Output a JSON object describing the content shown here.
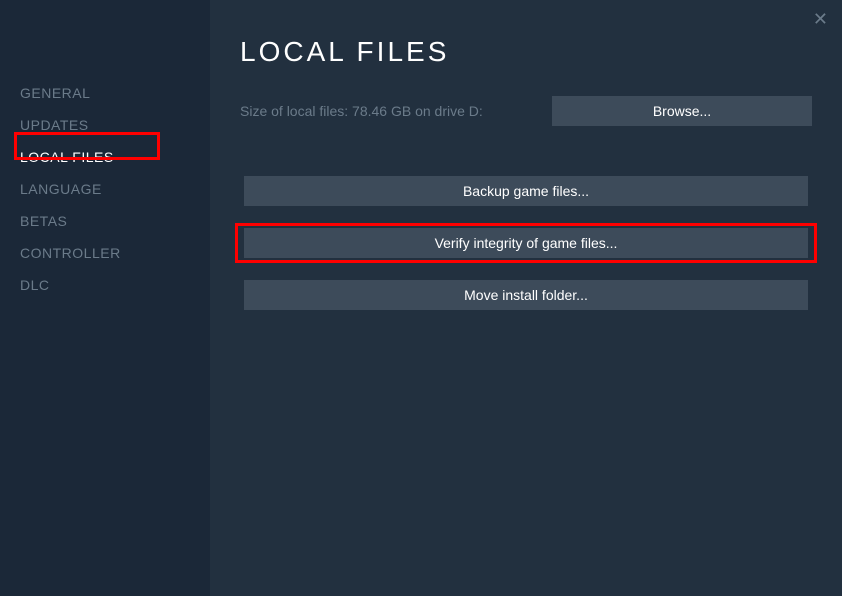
{
  "sidebar": {
    "items": [
      {
        "label": "GENERAL"
      },
      {
        "label": "UPDATES"
      },
      {
        "label": "LOCAL FILES"
      },
      {
        "label": "LANGUAGE"
      },
      {
        "label": "BETAS"
      },
      {
        "label": "CONTROLLER"
      },
      {
        "label": "DLC"
      }
    ]
  },
  "main": {
    "title": "LOCAL FILES",
    "size_info": "Size of local files: 78.46 GB on drive D:",
    "browse_label": "Browse...",
    "backup_label": "Backup game files...",
    "verify_label": "Verify integrity of game files...",
    "move_label": "Move install folder..."
  }
}
